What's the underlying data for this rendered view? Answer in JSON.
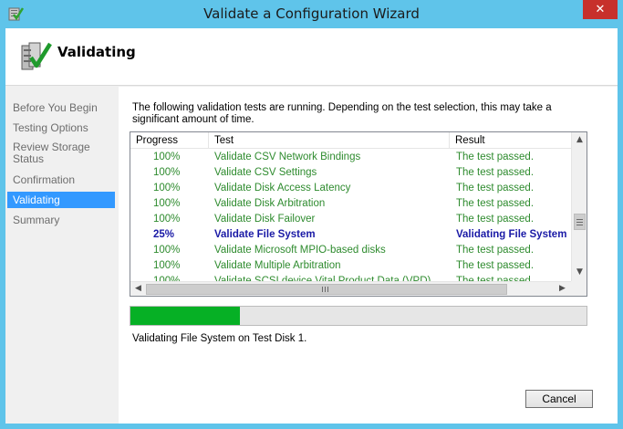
{
  "window": {
    "title": "Validate a Configuration Wizard",
    "close_glyph": "✕"
  },
  "header": {
    "title": "Validating"
  },
  "steps": [
    {
      "label": "Before You Begin"
    },
    {
      "label": "Testing Options"
    },
    {
      "label": "Review Storage Status"
    },
    {
      "label": "Confirmation"
    },
    {
      "label": "Validating"
    },
    {
      "label": "Summary"
    }
  ],
  "description": "The following validation tests are running. Depending on the test selection, this may take a significant amount of time.",
  "results": {
    "columns": [
      "Progress",
      "Test",
      "Result"
    ],
    "rows": [
      {
        "progress": "100%",
        "test": "Validate CSV Network Bindings",
        "result": "The test passed."
      },
      {
        "progress": "100%",
        "test": "Validate CSV Settings",
        "result": "The test passed."
      },
      {
        "progress": "100%",
        "test": "Validate Disk Access Latency",
        "result": "The test passed."
      },
      {
        "progress": "100%",
        "test": "Validate Disk Arbitration",
        "result": "The test passed."
      },
      {
        "progress": "100%",
        "test": "Validate Disk Failover",
        "result": "The test passed."
      },
      {
        "progress": "25%",
        "test": "Validate File System",
        "result": "Validating File System"
      },
      {
        "progress": "100%",
        "test": "Validate Microsoft MPIO-based disks",
        "result": "The test passed."
      },
      {
        "progress": "100%",
        "test": "Validate Multiple Arbitration",
        "result": "The test passed."
      },
      {
        "progress": "100%",
        "test": "Validate SCSI device Vital Product Data (VPD)",
        "result": "The test passed."
      }
    ]
  },
  "progress": {
    "fraction": 0.24
  },
  "status_text": "Validating File System on Test Disk 1.",
  "cancel_label": "Cancel",
  "colors": {
    "titlebar": "#5fc4ea",
    "passed": "#2e8b2e",
    "current": "#1a1aa6",
    "selection": "#3399ff",
    "progress_fill": "#06b025",
    "close": "#c7302b"
  },
  "icons": [
    "wizard-checklist-icon",
    "validation-checklist-icon",
    "close-icon",
    "scroll-up-icon",
    "scroll-down-icon",
    "scroll-left-icon",
    "scroll-right-icon"
  ]
}
